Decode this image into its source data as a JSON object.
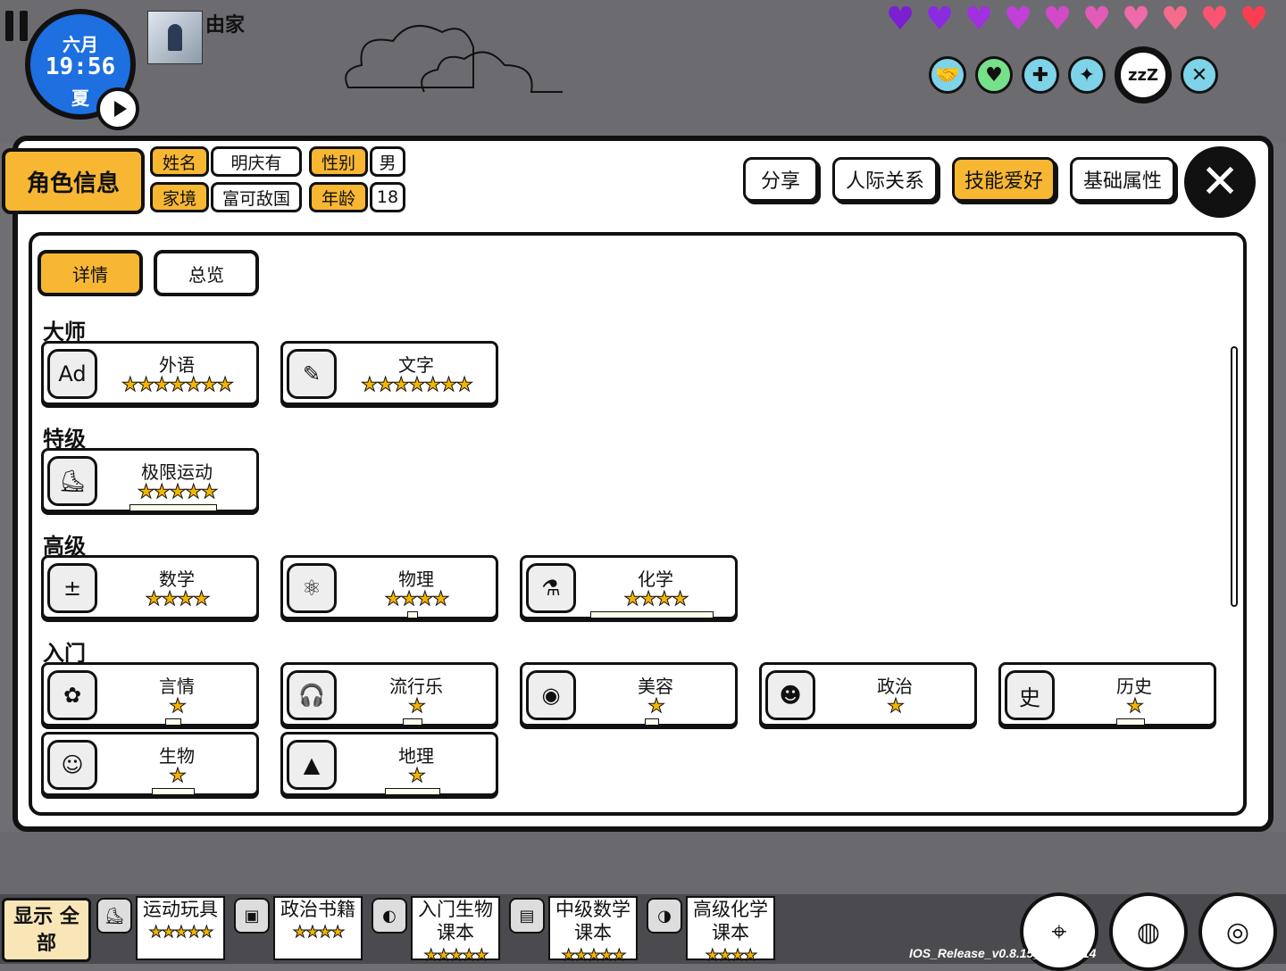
{
  "hud": {
    "month": "六月",
    "time": "19:56",
    "season": "夏",
    "location": "由家",
    "hearts": [
      "#7b1fd1",
      "#8a2be2",
      "#a030e0",
      "#c040d8",
      "#d34ac9",
      "#e25bb8",
      "#ee6aa8",
      "#f56b8c",
      "#fa5470",
      "#fb3d52"
    ],
    "status_icons": [
      "handshake-icon",
      "heart-icon",
      "gamepad-icon",
      "sparkle-icon",
      "sleep-icon",
      "fork-knife-icon"
    ],
    "sleep_label": "zzZ"
  },
  "profile": {
    "title": "角色信息",
    "name_label": "姓名",
    "name": "明庆有",
    "gender_label": "性别",
    "gender": "男",
    "family_label": "家境",
    "family": "富可敌国",
    "age_label": "年龄",
    "age": "18"
  },
  "top_buttons": {
    "share": "分享",
    "relations": "人际关系",
    "skills": "技能爱好",
    "attributes": "基础属性",
    "close": "✕"
  },
  "subtabs": {
    "detail": "详情",
    "overview": "总览"
  },
  "groups": {
    "master": "大师",
    "special": "特级",
    "advanced": "高级",
    "beginner": "入门"
  },
  "skills": {
    "foreign_lang": {
      "name": "外语",
      "stars": "★★★★★★★"
    },
    "writing": {
      "name": "文字",
      "stars": "★★★★★★★"
    },
    "extreme_sports": {
      "name": "极限运动",
      "stars": "★★★★★"
    },
    "math": {
      "name": "数学",
      "stars": "★★★★"
    },
    "physics": {
      "name": "物理",
      "stars": "★★★★"
    },
    "chemistry": {
      "name": "化学",
      "stars": "★★★★"
    },
    "romance": {
      "name": "言情",
      "stars": "★"
    },
    "pop_music": {
      "name": "流行乐",
      "stars": "★"
    },
    "beauty": {
      "name": "美容",
      "stars": "★"
    },
    "politics": {
      "name": "政治",
      "stars": "★"
    },
    "history": {
      "name": "历史",
      "stars": "★"
    },
    "biology": {
      "name": "生物",
      "stars": "★"
    },
    "geography": {
      "name": "地理",
      "stars": "★"
    }
  },
  "bottom": {
    "show_all": "显示 全部",
    "items": [
      {
        "name": "运动玩具",
        "stars": "★★★★★"
      },
      {
        "name": "政治书籍",
        "stars": "★★★★"
      },
      {
        "name": "入门生物 课本",
        "stars": "★★★★★"
      },
      {
        "name": "中级数学 课本",
        "stars": "★★★★★"
      },
      {
        "name": "高级化学 课本",
        "stars": "★★★★"
      }
    ],
    "version": "IOS_Release_v0.8.15_20200714"
  }
}
